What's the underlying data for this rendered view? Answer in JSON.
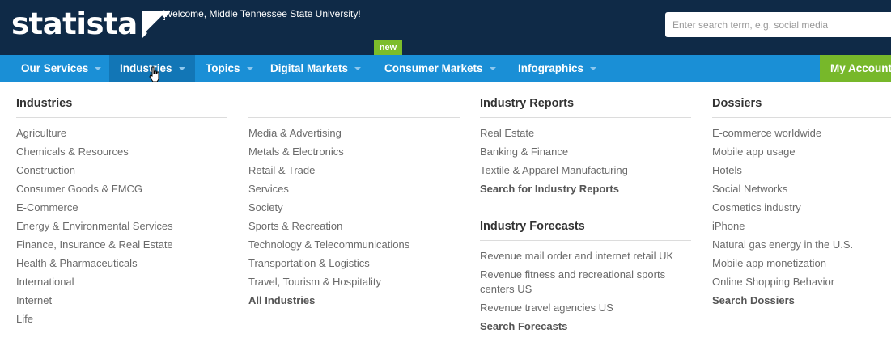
{
  "header": {
    "logo_text": "statista",
    "welcome": "Welcome, Middle Tennessee State University!",
    "search_placeholder": "Enter search term, e.g. social media"
  },
  "nav": {
    "items": [
      {
        "label": "Our Services"
      },
      {
        "label": "Industries"
      },
      {
        "label": "Topics"
      },
      {
        "label": "Digital Markets"
      },
      {
        "label": "Consumer Markets"
      },
      {
        "label": "Infographics"
      }
    ],
    "new_badge": "new",
    "account_label": "My Account"
  },
  "menu": {
    "industries": {
      "title": "Industries",
      "col1": [
        "Agriculture",
        "Chemicals & Resources",
        "Construction",
        "Consumer Goods & FMCG",
        "E-Commerce",
        "Energy & Environmental Services",
        "Finance, Insurance & Real Estate",
        "Health & Pharmaceuticals",
        "International",
        "Internet",
        "Life"
      ],
      "col2": [
        "Media & Advertising",
        "Metals & Electronics",
        "Retail & Trade",
        "Services",
        "Society",
        "Sports & Recreation",
        "Technology & Telecommunications",
        "Transportation & Logistics",
        "Travel, Tourism & Hospitality"
      ],
      "all_link": "All Industries"
    },
    "reports": {
      "title": "Industry Reports",
      "items": [
        "Real Estate",
        "Banking & Finance",
        "Textile & Apparel Manufacturing"
      ],
      "search_link": "Search for Industry Reports"
    },
    "forecasts": {
      "title": "Industry Forecasts",
      "items": [
        "Revenue mail order and internet retail UK",
        "Revenue fitness and recreational sports centers US",
        "Revenue travel agencies US"
      ],
      "search_link": "Search Forecasts"
    },
    "dossiers": {
      "title": "Dossiers",
      "items": [
        "E-commerce worldwide",
        "Mobile app usage",
        "Hotels",
        "Social Networks",
        "Cosmetics industry",
        "iPhone",
        "Natural gas energy in the U.S.",
        "Mobile app monetization",
        "Online Shopping Behavior"
      ],
      "search_link": "Search Dossiers"
    }
  },
  "colors": {
    "topbar": "#0f2a47",
    "navbar": "#1a8fd6",
    "nav_active": "#1276b6",
    "accent_green": "#77b82a"
  }
}
